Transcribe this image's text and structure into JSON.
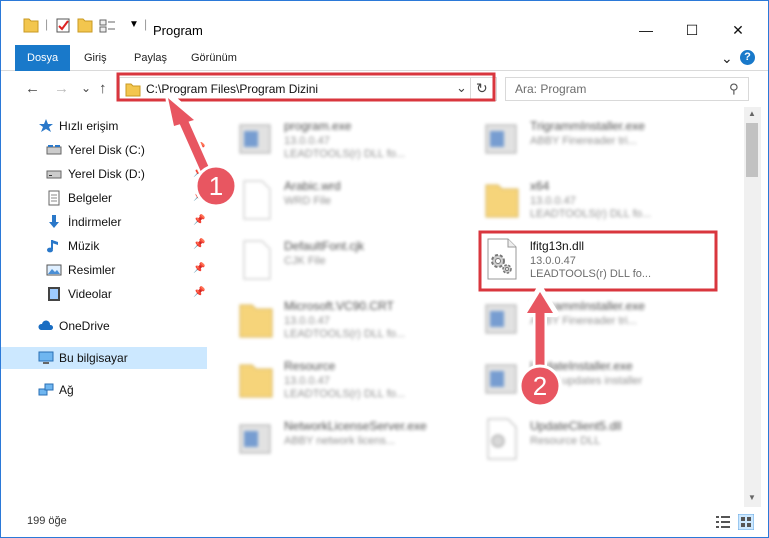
{
  "window": {
    "title": "Program",
    "minimize_glyph": "—",
    "maximize_glyph": "☐",
    "close_glyph": "✕"
  },
  "ribbon": {
    "tabs": [
      "Dosya",
      "Giriş",
      "Paylaş",
      "Görünüm"
    ],
    "expand_glyph": "⌄",
    "help_glyph": "?"
  },
  "nav": {
    "back_glyph": "←",
    "forward_glyph": "→",
    "recent_glyph": "⌄",
    "up_glyph": "↑",
    "address": "C:\\Program Files\\Program Dizini",
    "address_dropdown_glyph": "⌄",
    "refresh_glyph": "↻",
    "search_placeholder": "Ara: Program",
    "search_glyph": "⚲"
  },
  "sidebar": {
    "items": [
      {
        "label": "Hızlı erişim",
        "icon": "star-icon"
      },
      {
        "label": "Yerel Disk (C:)",
        "icon": "drive-icon"
      },
      {
        "label": "Yerel Disk (D:)",
        "icon": "drive-icon"
      },
      {
        "label": "Belgeler",
        "icon": "documents-icon"
      },
      {
        "label": "İndirmeler",
        "icon": "download-icon"
      },
      {
        "label": "Müzik",
        "icon": "music-icon"
      },
      {
        "label": "Resimler",
        "icon": "pictures-icon"
      },
      {
        "label": "Videolar",
        "icon": "videos-icon"
      },
      {
        "label": "OneDrive",
        "icon": "cloud-icon"
      },
      {
        "label": "Bu bilgisayar",
        "icon": "computer-icon"
      },
      {
        "label": "Ağ",
        "icon": "network-icon"
      }
    ],
    "pin_glyph": "📌"
  },
  "files": {
    "left": [
      {
        "name": "program.exe",
        "line1": "13.0.0.47",
        "line2": "LEADTOOLS(r) DLL fo..."
      },
      {
        "name": "Arabic.wrd",
        "line1": "WRD File",
        "line2": ""
      },
      {
        "name": "DefaultFont.cjk",
        "line1": "CJK File",
        "line2": ""
      },
      {
        "name": "Microsoft.VC90.CRT",
        "line1": "13.0.0.47",
        "line2": "LEADTOOLS(r) DLL fo..."
      },
      {
        "name": "Resource",
        "line1": "13.0.0.47",
        "line2": "LEADTOOLS(r) DLL fo..."
      },
      {
        "name": "NetworkLicenseServer.exe",
        "line1": "ABBY network licens...",
        "line2": ""
      }
    ],
    "right": [
      {
        "name": "TrigrammInstaller.exe",
        "line1": "ABBY Finereader tri...",
        "line2": ""
      },
      {
        "name": "x64",
        "line1": "13.0.0.47",
        "line2": "LEADTOOLS(r) DLL fo..."
      },
      {
        "name": "lfitg13n.dll",
        "line1": "13.0.0.47",
        "line2": "LEADTOOLS(r) DLL fo..."
      },
      {
        "name": "TrigrammInstaller.exe",
        "line1": "ABBY Finereader tri...",
        "line2": ""
      },
      {
        "name": "UpdateInstaller.exe",
        "line1": "ABBY updates installer",
        "line2": ""
      },
      {
        "name": "UpdateClient5.dll",
        "line1": "Resource DLL",
        "line2": ""
      }
    ]
  },
  "status": {
    "item_count": "199 öğe"
  },
  "annotations": {
    "step1": "1",
    "step2": "2",
    "highlight_color": "#d9363e"
  },
  "colors": {
    "accent": "#1979ca",
    "selected_bg": "#cce8ff",
    "folder": "#f3c64e"
  }
}
